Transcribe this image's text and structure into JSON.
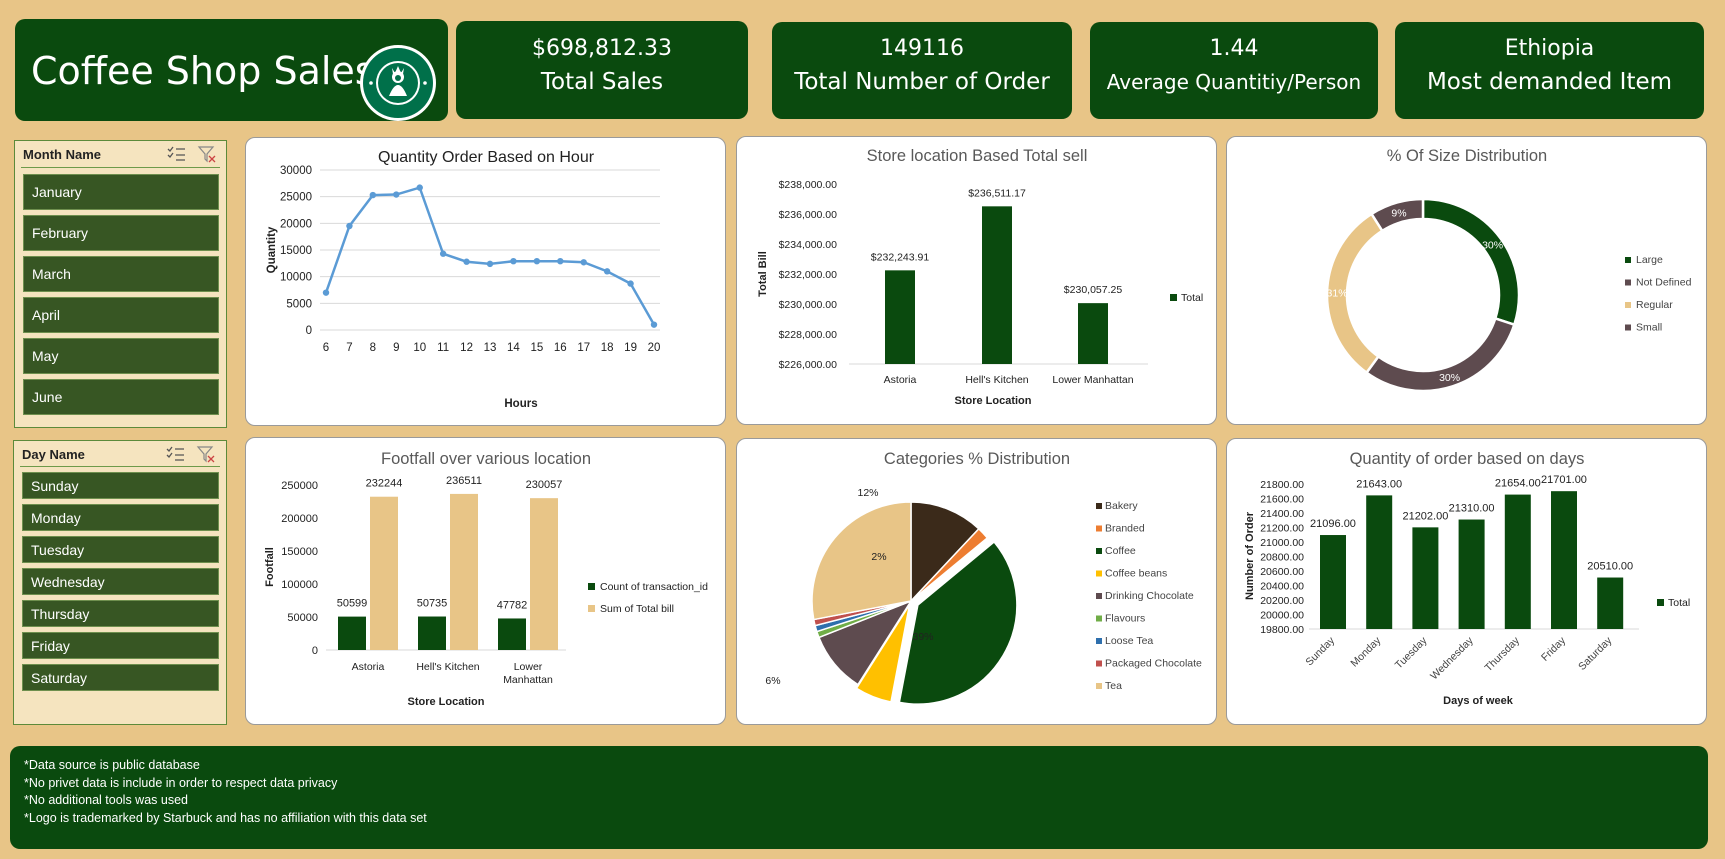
{
  "header": {
    "title": "Coffee Shop Sales",
    "logo_text": "STARBUCKS COFFEE"
  },
  "kpis": [
    {
      "value": "$698,812.33",
      "label": "Total Sales"
    },
    {
      "value": "149116",
      "label": "Total Number of Order"
    },
    {
      "value": "1.44",
      "label": "Average Quantitiy/Person"
    },
    {
      "value": "Ethiopia",
      "label": "Most demanded Item"
    }
  ],
  "slicers": {
    "month": {
      "title": "Month Name",
      "items": [
        "January",
        "February",
        "March",
        "April",
        "May",
        "June"
      ]
    },
    "day": {
      "title": "Day Name",
      "items": [
        "Sunday",
        "Monday",
        "Tuesday",
        "Wednesday",
        "Thursday",
        "Friday",
        "Saturday"
      ]
    }
  },
  "icons": {
    "multi_select": "multi-select-icon",
    "clear_filter": "clear-filter-icon"
  },
  "colors": {
    "background": "#E8C587",
    "dark_green": "#0A4A0E",
    "slicer_item": "#375623",
    "line_blue": "#5B9BD5",
    "tan": "#E8C587",
    "mauve": "#5E4B4F"
  },
  "chart_data": [
    {
      "type": "line",
      "title": "Quantity Order Based on Hour",
      "xlabel": "Hours",
      "ylabel": "Quantity",
      "x": [
        6,
        7,
        8,
        9,
        10,
        11,
        12,
        13,
        14,
        15,
        16,
        17,
        18,
        19,
        20
      ],
      "values": [
        7000,
        19500,
        25300,
        25400,
        26700,
        14300,
        12800,
        12400,
        12900,
        12900,
        12900,
        12700,
        11000,
        8700,
        1000
      ],
      "ylim": [
        0,
        30000
      ],
      "yticks": [
        0,
        5000,
        10000,
        15000,
        20000,
        25000,
        30000
      ],
      "grid": true
    },
    {
      "type": "bar",
      "title": "Store location Based Total sell",
      "xlabel": "Store Location",
      "ylabel": "Total Bill",
      "categories": [
        "Astoria",
        "Hell's Kitchen",
        "Lower Manhattan"
      ],
      "values": [
        232243.91,
        236511.17,
        230057.25
      ],
      "data_labels": [
        "$232,243.91",
        "$236,511.17",
        "$230,057.25"
      ],
      "ylim": [
        226000,
        238000
      ],
      "yticks": [
        "$226,000.00",
        "$228,000.00",
        "$230,000.00",
        "$232,000.00",
        "$234,000.00",
        "$236,000.00",
        "$238,000.00"
      ],
      "legend": [
        "Total"
      ],
      "legend_position": "right"
    },
    {
      "type": "pie",
      "title": "% Of Size Distribution",
      "labels": [
        "Large",
        "Not Defined",
        "Regular",
        "Small"
      ],
      "values": [
        30,
        30,
        31,
        9
      ],
      "data_labels": [
        "30%",
        "30%",
        "31%",
        "9%"
      ],
      "colors": [
        "#0A4A0E",
        "#5E4B4F",
        "#E8C587",
        "#5E4B4F"
      ],
      "legend_position": "right"
    },
    {
      "type": "bar",
      "title": "Footfall over various location",
      "xlabel": "Store Location",
      "ylabel": "Footfall",
      "categories": [
        "Astoria",
        "Hell's Kitchen",
        "Lower Manhattan"
      ],
      "series": [
        {
          "name": "Count of transaction_id",
          "values": [
            50599,
            50735,
            47782
          ]
        },
        {
          "name": "Sum of Total bill",
          "values": [
            232244,
            236511,
            230057
          ]
        }
      ],
      "ylim": [
        0,
        250000
      ],
      "yticks": [
        0,
        50000,
        100000,
        150000,
        200000,
        250000
      ],
      "legend_position": "right"
    },
    {
      "type": "pie",
      "title": "Categories % Distribution",
      "labels": [
        "Bakery",
        "Branded",
        "Coffee",
        "Coffee beans",
        "Drinking Chocolate",
        "Flavours",
        "Loose Tea",
        "Packaged Chocolate",
        "Tea"
      ],
      "values": [
        12,
        2,
        39,
        6,
        10,
        1,
        1,
        1,
        28
      ],
      "data_labels": [
        "12%",
        "2%",
        "39%",
        "6%",
        "10%",
        "1%",
        "1%",
        "1%",
        "28%"
      ],
      "colors": [
        "#3B2A1A",
        "#ED7D31",
        "#0A4A0E",
        "#FFC000",
        "#5E4B4F",
        "#70AD47",
        "#2E6FAD",
        "#C0504D",
        "#E8C587"
      ],
      "legend_position": "right"
    },
    {
      "type": "bar",
      "title": "Quantity of order based on days",
      "xlabel": "Days of week",
      "ylabel": "Number of Order",
      "categories": [
        "Sunday",
        "Monday",
        "Tuesday",
        "Wednesday",
        "Thursday",
        "Friday",
        "Saturday"
      ],
      "values": [
        21096,
        21643,
        21202,
        21310,
        21654,
        21701,
        20510
      ],
      "data_labels": [
        "21096.00",
        "21643.00",
        "21202.00",
        "21310.00",
        "21654.00",
        "21701.00",
        "20510.00"
      ],
      "ylim": [
        19800,
        21800
      ],
      "yticks": [
        "19800.00",
        "20000.00",
        "20200.00",
        "20400.00",
        "20600.00",
        "20800.00",
        "21000.00",
        "21200.00",
        "21400.00",
        "21600.00",
        "21800.00"
      ],
      "legend": [
        "Total"
      ],
      "legend_position": "right"
    }
  ],
  "footer": {
    "lines": [
      "*Data source is public database",
      "*No privet data is include in order to respect data privacy",
      "*No additional tools was used",
      "*Logo is trademarked by Starbuck and has no affiliation with this data set"
    ]
  }
}
